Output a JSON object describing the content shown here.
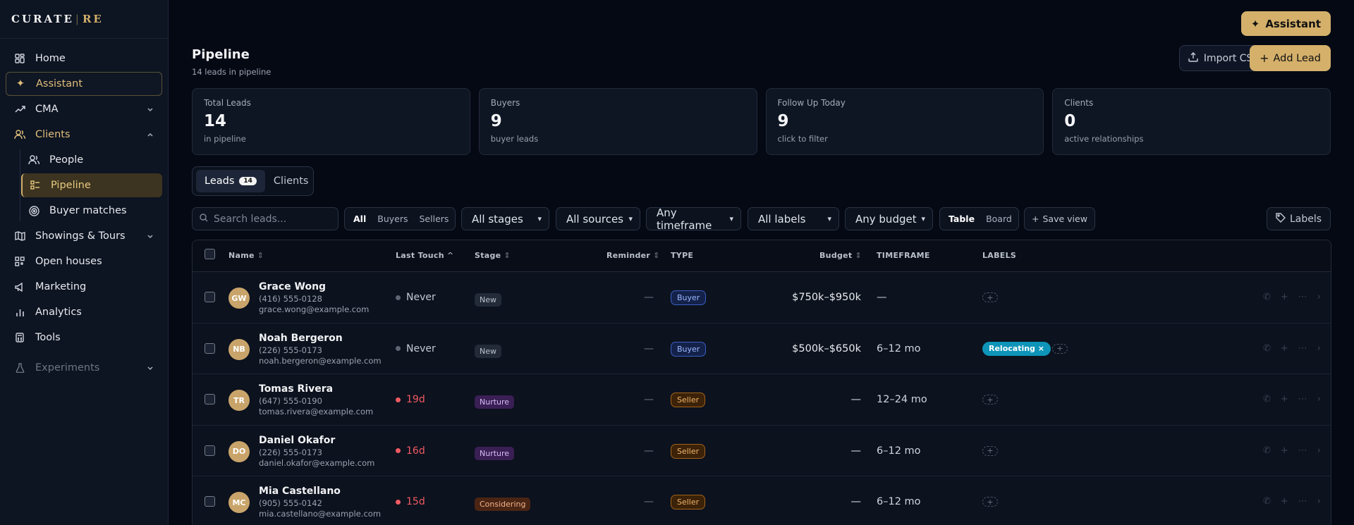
{
  "brand": {
    "name": "CURATE",
    "separator": "|",
    "suffix": "RE"
  },
  "sidebar": {
    "items": [
      {
        "label": "Home"
      },
      {
        "label": "Assistant"
      },
      {
        "label": "CMA"
      },
      {
        "label": "Clients"
      },
      {
        "label": "People"
      },
      {
        "label": "Pipeline"
      },
      {
        "label": "Buyer matches"
      },
      {
        "label": "Showings & Tours"
      },
      {
        "label": "Open houses"
      },
      {
        "label": "Marketing"
      },
      {
        "label": "Analytics"
      },
      {
        "label": "Tools"
      },
      {
        "label": "Experiments"
      }
    ]
  },
  "header": {
    "assistant_label": "Assistant",
    "title": "Pipeline",
    "subtitle": "14 leads in pipeline",
    "import_label": "Import CSV",
    "add_label": "Add Lead"
  },
  "stats": [
    {
      "label": "Total Leads",
      "value": "14",
      "hint": "in pipeline"
    },
    {
      "label": "Buyers",
      "value": "9",
      "hint": "buyer leads"
    },
    {
      "label": "Follow Up Today",
      "value": "9",
      "hint": "click to filter"
    },
    {
      "label": "Clients",
      "value": "0",
      "hint": "active relationships"
    }
  ],
  "tabs": {
    "leads": "Leads",
    "leads_count": "14",
    "clients": "Clients"
  },
  "filters": {
    "search_placeholder": "Search leads...",
    "type_options": [
      "All",
      "Buyers",
      "Sellers"
    ],
    "stage": "All stages",
    "source": "All sources",
    "timeframe": "Any timeframe",
    "labels": "All labels",
    "budget": "Any budget",
    "view_options": [
      "Table",
      "Board"
    ],
    "save_view": "Save view",
    "labels_button": "Labels"
  },
  "table": {
    "columns": {
      "name": "Name",
      "last_touch": "Last Touch",
      "stage": "Stage",
      "reminder": "Reminder",
      "type": "TYPE",
      "budget": "Budget",
      "timeframe": "TIMEFRAME",
      "labels": "LABELS"
    },
    "rows": [
      {
        "initials": "GW",
        "name": "Grace Wong",
        "phone": "(416) 555-0128",
        "email": "grace.wong@example.com",
        "last_touch": "Never",
        "stage": "New",
        "reminder": "—",
        "type": "Buyer",
        "budget": "$750k–$950k",
        "timeframe": "—",
        "label": ""
      },
      {
        "initials": "NB",
        "name": "Noah Bergeron",
        "phone": "(226) 555-0173",
        "email": "noah.bergeron@example.com",
        "last_touch": "Never",
        "stage": "New",
        "reminder": "—",
        "type": "Buyer",
        "budget": "$500k–$650k",
        "timeframe": "6–12 mo",
        "label": "Relocating ×"
      },
      {
        "initials": "TR",
        "name": "Tomas Rivera",
        "phone": "(647) 555-0190",
        "email": "tomas.rivera@example.com",
        "last_touch": "19d",
        "stage": "Nurture",
        "reminder": "—",
        "type": "Seller",
        "budget": "—",
        "timeframe": "12–24 mo",
        "label": ""
      },
      {
        "initials": "DO",
        "name": "Daniel Okafor",
        "phone": "(226) 555-0173",
        "email": "daniel.okafor@example.com",
        "last_touch": "16d",
        "stage": "Nurture",
        "reminder": "—",
        "type": "Seller",
        "budget": "—",
        "timeframe": "6–12 mo",
        "label": ""
      },
      {
        "initials": "MC",
        "name": "Mia Castellano",
        "phone": "(905) 555-0142",
        "email": "mia.castellano@example.com",
        "last_touch": "15d",
        "stage": "Considering",
        "reminder": "—",
        "type": "Seller",
        "budget": "—",
        "timeframe": "6–12 mo",
        "label": ""
      }
    ]
  },
  "colors": {
    "accent": "#d4b06a",
    "background": "#050914",
    "sidebar": "#0d1422",
    "danger": "#f05a62",
    "label_chip": "#0d94b8"
  }
}
